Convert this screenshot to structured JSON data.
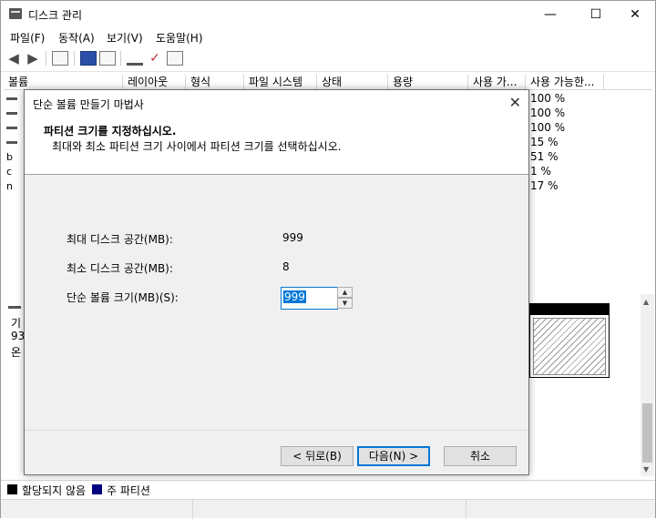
{
  "window": {
    "title": "디스크 관리",
    "controls": {
      "minimize": "—",
      "maximize": "☐",
      "close": "✕"
    }
  },
  "menu": {
    "items": [
      "파일(F)",
      "동작(A)",
      "보기(V)",
      "도움말(H)"
    ]
  },
  "volume_table": {
    "columns": [
      "볼륨",
      "레이아웃",
      "형식",
      "파일 시스템",
      "상태",
      "용량",
      "사용 가...",
      "사용 가능한..."
    ],
    "free_percent": [
      "100 %",
      "100 %",
      "100 %",
      "15 %",
      "51 %",
      "1 %",
      "17 %"
    ],
    "row_letters": [
      "b",
      "c",
      "n"
    ]
  },
  "lower_pane": {
    "fragments": [
      "기",
      "93",
      "온"
    ]
  },
  "legend": {
    "items": [
      {
        "label": "할당되지 않음",
        "color": "#000000"
      },
      {
        "label": "주 파티션",
        "color": "#000080"
      }
    ]
  },
  "dialog": {
    "title": "단순 볼륨 만들기 마법사",
    "heading": "파티션 크기를 지정하십시오.",
    "subheading": "최대와 최소 파티션 크기 사이에서 파티션 크기를 선택하십시오.",
    "max_label": "최대 디스크 공간(MB):",
    "max_value": "999",
    "min_label": "최소 디스크 공간(MB):",
    "min_value": "8",
    "size_label": "단순 볼륨 크기(MB)(S):",
    "size_value": "999",
    "buttons": {
      "back": "< 뒤로(B)",
      "next": "다음(N) >",
      "cancel": "취소"
    }
  },
  "colors": {
    "accent": "#0078d7",
    "dialog_bg": "#f0f0f0"
  }
}
